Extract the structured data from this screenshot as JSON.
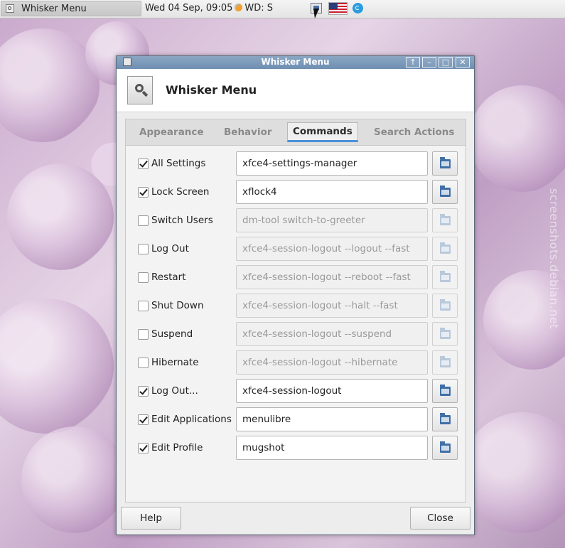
{
  "panel": {
    "task_label": "Whisker Menu",
    "clock_prefix": "Wed 04 Sep, 09:05",
    "weather": "WD: S"
  },
  "watermark": "screenshots.debian.net",
  "dialog": {
    "window_title": "Whisker Menu",
    "header_title": "Whisker Menu",
    "tabs": [
      {
        "label": "Appearance",
        "active": false
      },
      {
        "label": "Behavior",
        "active": false
      },
      {
        "label": "Commands",
        "active": true
      },
      {
        "label": "Search Actions",
        "active": false
      }
    ],
    "commands": [
      {
        "label": "All Settings",
        "checked": true,
        "command": "xfce4-settings-manager"
      },
      {
        "label": "Lock Screen",
        "checked": true,
        "command": "xflock4"
      },
      {
        "label": "Switch Users",
        "checked": false,
        "command": "dm-tool switch-to-greeter"
      },
      {
        "label": "Log Out",
        "checked": false,
        "command": "xfce4-session-logout --logout --fast"
      },
      {
        "label": "Restart",
        "checked": false,
        "command": "xfce4-session-logout --reboot --fast"
      },
      {
        "label": "Shut Down",
        "checked": false,
        "command": "xfce4-session-logout --halt --fast"
      },
      {
        "label": "Suspend",
        "checked": false,
        "command": "xfce4-session-logout --suspend"
      },
      {
        "label": "Hibernate",
        "checked": false,
        "command": "xfce4-session-logout --hibernate"
      },
      {
        "label": "Log Out...",
        "checked": true,
        "command": "xfce4-session-logout"
      },
      {
        "label": "Edit Applications",
        "checked": true,
        "command": "menulibre"
      },
      {
        "label": "Edit Profile",
        "checked": true,
        "command": "mugshot"
      }
    ],
    "help_label": "Help",
    "close_label": "Close"
  },
  "colors": {
    "titlebar": "#7d9bbd",
    "active_tab_underline": "#4a90d9"
  }
}
